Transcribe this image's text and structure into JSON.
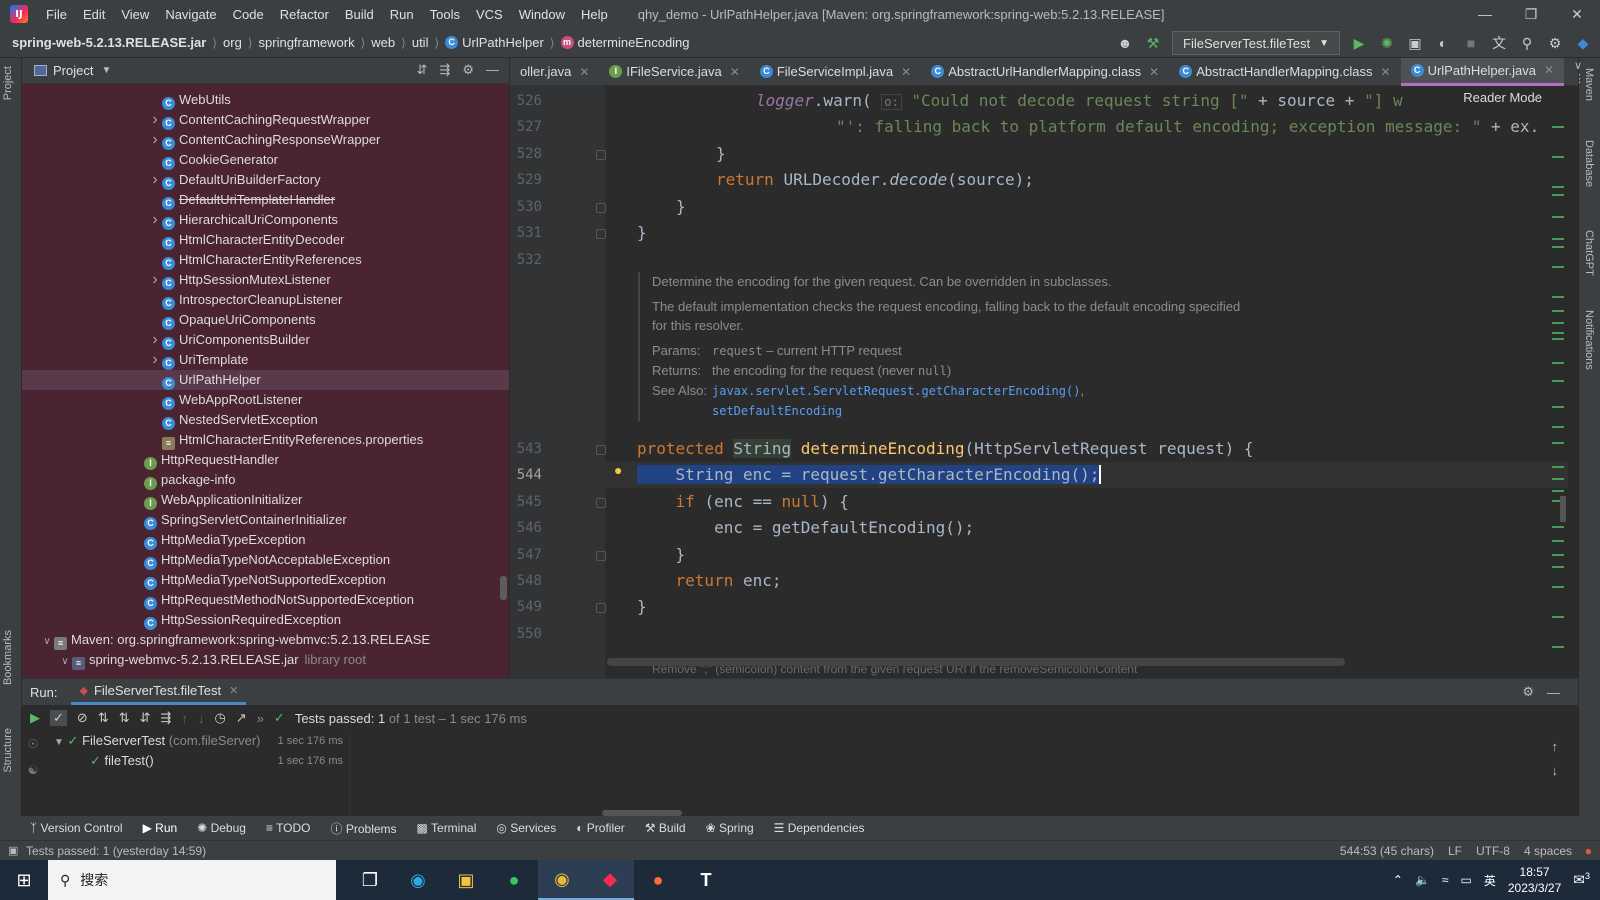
{
  "titlebar": {
    "menu": [
      "File",
      "Edit",
      "View",
      "Navigate",
      "Code",
      "Refactor",
      "Build",
      "Run",
      "Tools",
      "VCS",
      "Window",
      "Help"
    ],
    "title": "qhy_demo - UrlPathHelper.java [Maven: org.springframework:spring-web:5.2.13.RELEASE]"
  },
  "navbar": {
    "crumbs": [
      "spring-web-5.2.13.RELEASE.jar",
      "org",
      "springframework",
      "web",
      "util",
      "UrlPathHelper",
      "determineEncoding"
    ],
    "run_config": "FileServerTest.fileTest"
  },
  "project": {
    "title": "Project",
    "rows": [
      {
        "label": "WebUtils",
        "icon": "C",
        "arrow": false,
        "indent": 2
      },
      {
        "label": "ContentCachingRequestWrapper",
        "icon": "C",
        "arrow": true,
        "indent": 2
      },
      {
        "label": "ContentCachingResponseWrapper",
        "icon": "C",
        "arrow": true,
        "indent": 2
      },
      {
        "label": "CookieGenerator",
        "icon": "C",
        "arrow": false,
        "indent": 2
      },
      {
        "label": "DefaultUriBuilderFactory",
        "icon": "C",
        "arrow": true,
        "indent": 2
      },
      {
        "label": "DefaultUriTemplateHandler",
        "icon": "C",
        "arrow": false,
        "indent": 2,
        "strike": true
      },
      {
        "label": "HierarchicalUriComponents",
        "icon": "C",
        "arrow": true,
        "indent": 2
      },
      {
        "label": "HtmlCharacterEntityDecoder",
        "icon": "C",
        "arrow": false,
        "indent": 2
      },
      {
        "label": "HtmlCharacterEntityReferences",
        "icon": "C",
        "arrow": false,
        "indent": 2
      },
      {
        "label": "HttpSessionMutexListener",
        "icon": "C",
        "arrow": true,
        "indent": 2
      },
      {
        "label": "IntrospectorCleanupListener",
        "icon": "C",
        "arrow": false,
        "indent": 2
      },
      {
        "label": "OpaqueUriComponents",
        "icon": "C",
        "arrow": false,
        "indent": 2
      },
      {
        "label": "UriComponentsBuilder",
        "icon": "C",
        "arrow": true,
        "indent": 2
      },
      {
        "label": "UriTemplate",
        "icon": "C",
        "arrow": true,
        "indent": 2
      },
      {
        "label": "UrlPathHelper",
        "icon": "C",
        "arrow": false,
        "indent": 2,
        "selected": true
      },
      {
        "label": "WebAppRootListener",
        "icon": "C",
        "arrow": false,
        "indent": 2
      },
      {
        "label": "NestedServletException",
        "icon": "C",
        "arrow": false,
        "indent": 2
      },
      {
        "label": "HtmlCharacterEntityReferences.properties",
        "icon": "P",
        "arrow": false,
        "indent": 2
      },
      {
        "label": "HttpRequestHandler",
        "icon": "I",
        "arrow": false,
        "indent": 1
      },
      {
        "label": "package-info",
        "icon": "I",
        "arrow": false,
        "indent": 1
      },
      {
        "label": "WebApplicationInitializer",
        "icon": "I",
        "arrow": false,
        "indent": 1
      },
      {
        "label": "SpringServletContainerInitializer",
        "icon": "C",
        "arrow": false,
        "indent": 1
      },
      {
        "label": "HttpMediaTypeException",
        "icon": "C",
        "arrow": false,
        "indent": 1
      },
      {
        "label": "HttpMediaTypeNotAcceptableException",
        "icon": "C",
        "arrow": false,
        "indent": 1
      },
      {
        "label": "HttpMediaTypeNotSupportedException",
        "icon": "C",
        "arrow": false,
        "indent": 1
      },
      {
        "label": "HttpRequestMethodNotSupportedException",
        "icon": "C",
        "arrow": false,
        "indent": 1
      },
      {
        "label": "HttpSessionRequiredException",
        "icon": "C",
        "arrow": false,
        "indent": 1
      },
      {
        "label": "Maven: org.springframework:spring-webmvc:5.2.13.RELEASE",
        "icon": "L",
        "arrow": "open",
        "indent": -1
      },
      {
        "label": "spring-webmvc-5.2.13.RELEASE.jar",
        "icon": "J",
        "arrow": "open",
        "indent": 0,
        "muted": "library root"
      }
    ]
  },
  "tabs": [
    {
      "label": "oller.java",
      "icon": "none"
    },
    {
      "label": "IFileService.java",
      "icon": "I"
    },
    {
      "label": "FileServiceImpl.java",
      "icon": "C"
    },
    {
      "label": "AbstractUrlHandlerMapping.class",
      "icon": "C"
    },
    {
      "label": "AbstractHandlerMapping.class",
      "icon": "C"
    },
    {
      "label": "UrlPathHelper.java",
      "icon": "C",
      "active": true
    }
  ],
  "editor": {
    "reader_mode": "Reader Mode",
    "line_numbers": [
      "526",
      "527",
      "528",
      "529",
      "530",
      "531",
      "532",
      "543",
      "544",
      "545",
      "546",
      "547",
      "548",
      "549",
      "550"
    ],
    "doc": {
      "summary": "Determine the encoding for the given request. Can be overridden in subclasses.",
      "detail": "The default implementation checks the request encoding, falling back to the default encoding specified for this resolver.",
      "params_label": "Params:",
      "params_name": "request",
      "params_text": "– current HTTP request",
      "returns_label": "Returns:",
      "returns_text": "the encoding for the request (never",
      "returns_null": "null",
      "returns_end": ")",
      "seealso_label": "See Also:",
      "seealso_1": "javax.servlet.ServletRequest.getCharacterEncoding()",
      "seealso_comma": ",",
      "seealso_2": "setDefaultEncoding"
    },
    "bottom_hint": "Remove \";\" (semicolon) content from the given request URI if the removeSemicolonContent"
  },
  "run": {
    "label": "Run:",
    "tab": "FileServerTest.fileTest",
    "status_prefix": "Tests passed:",
    "status_count": "1",
    "status_rest": "of 1 test – 1 sec 176 ms",
    "tree": [
      {
        "name": "FileServerTest",
        "detail": "(com.fileServer)",
        "time": "1 sec 176 ms"
      },
      {
        "name": "fileTest()",
        "detail": "",
        "time": "1 sec 176 ms"
      }
    ]
  },
  "tooltabs": [
    "Version Control",
    "Run",
    "Debug",
    "TODO",
    "Problems",
    "Terminal",
    "Services",
    "Profiler",
    "Build",
    "Spring",
    "Dependencies"
  ],
  "statusbar": {
    "message": "Tests passed: 1 (yesterday 14:59)",
    "position": "544:53 (45 chars)",
    "line_sep": "LF",
    "encoding": "UTF-8",
    "indent": "4 spaces"
  },
  "left_strip": [
    "Project",
    "Bookmarks",
    "Structure"
  ],
  "right_strip": [
    "Maven",
    "Database",
    "ChatGPT",
    "Notifications"
  ],
  "taskbar": {
    "search": "搜索",
    "ime": "英",
    "time": "18:57",
    "date": "2023/3/27",
    "notif_count": "3"
  }
}
